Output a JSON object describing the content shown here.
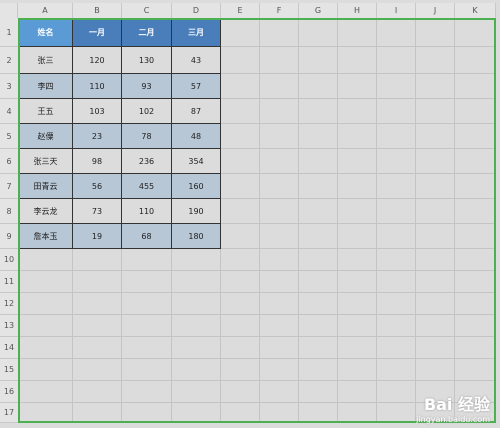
{
  "columns": [
    "A",
    "B",
    "C",
    "D",
    "E",
    "F",
    "G",
    "H",
    "I",
    "J",
    "K"
  ],
  "rows": [
    "1",
    "2",
    "3",
    "4",
    "5",
    "6",
    "7",
    "8",
    "9",
    "10",
    "11",
    "12",
    "13",
    "14",
    "15",
    "16",
    "17"
  ],
  "table": {
    "headers": [
      "姓名",
      "一月",
      "二月",
      "三月"
    ],
    "data": [
      [
        "张三",
        "120",
        "130",
        "43"
      ],
      [
        "李四",
        "110",
        "93",
        "57"
      ],
      [
        "王五",
        "103",
        "102",
        "87"
      ],
      [
        "赵僳",
        "23",
        "78",
        "48"
      ],
      [
        "张三天",
        "98",
        "236",
        "354"
      ],
      [
        "田青云",
        "56",
        "455",
        "160"
      ],
      [
        "李云龙",
        "73",
        "110",
        "190"
      ],
      [
        "詹本玉",
        "19",
        "68",
        "180"
      ]
    ]
  },
  "colors": {
    "header_name": "#5b9bd5",
    "header_month": "#4a7ebb",
    "row_alt": "#b7c7d6",
    "row_plain": "#dcdcdc",
    "selection_outline": "#4caf50"
  },
  "watermark": {
    "logo": "Bai 经验",
    "url": "jingyan.baidu.com"
  }
}
